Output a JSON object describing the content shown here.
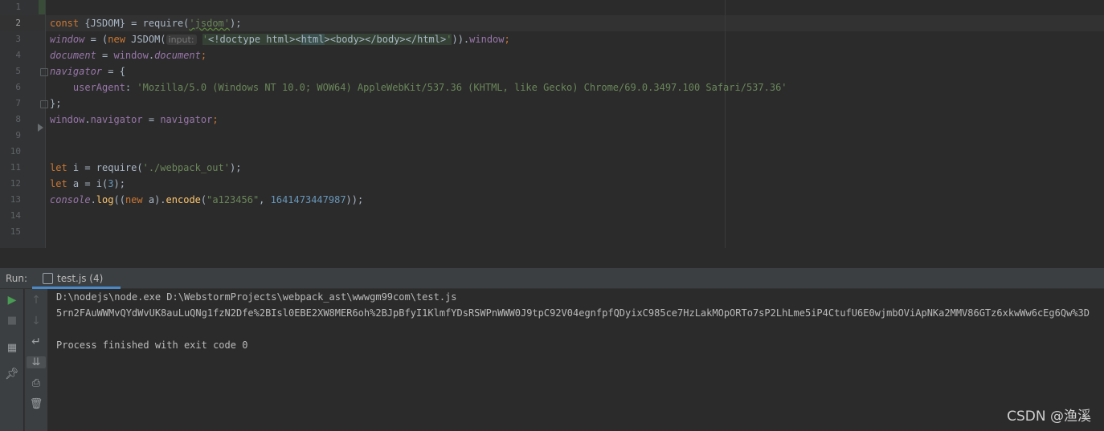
{
  "editor": {
    "line_numbers": [
      "1",
      "2",
      "3",
      "4",
      "5",
      "6",
      "7",
      "8",
      "9",
      "10",
      "11",
      "12",
      "13",
      "14",
      "15"
    ],
    "l2": {
      "a": "const ",
      "b": "{JSDOM}",
      "c": " = require(",
      "d": "'jsdom'",
      "e": ");"
    },
    "l3": {
      "a": "window",
      "b": " = (",
      "c": "new ",
      "d": "JSDOM(",
      "hint": "input:",
      "e": "'",
      "f": "<!doctype html><",
      "g": "html",
      "h": "><body></body></html>",
      "i": "'",
      "j": ")).",
      "k": "window",
      "l": ";"
    },
    "l4": {
      "a": "document",
      "b": " = ",
      "c": "window",
      "d": ".",
      "e": "document",
      "f": ";"
    },
    "l5": {
      "a": "navigator",
      "b": " = {"
    },
    "l6": {
      "a": "    userAgent",
      "b": ": ",
      "c": "'Mozilla/5.0 (Windows NT 10.0; WOW64) AppleWebKit/537.36 (KHTML, like Gecko) Chrome/69.0.3497.100 Safari/537.36'"
    },
    "l7": {
      "a": "};"
    },
    "l8": {
      "a": "window",
      "b": ".",
      "c": "navigator",
      "d": " = ",
      "e": "navigator",
      "f": ";"
    },
    "l11": {
      "a": "let ",
      "b": "i = require(",
      "c": "'./webpack_out'",
      "d": ");"
    },
    "l12": {
      "a": "let ",
      "b": "a = i(",
      "c": "3",
      "d": ");"
    },
    "l13": {
      "a": "console",
      "b": ".",
      "c": "log",
      "d": "((",
      "e": "new ",
      "f": "a).",
      "g": "encode",
      "h": "(",
      "i": "\"a123456\"",
      "j": ", ",
      "k": "1641473447987",
      "l": "));"
    }
  },
  "run_panel": {
    "label": "Run:",
    "tab_label": "test.js (4)",
    "console_lines": [
      "D:\\nodejs\\node.exe D:\\WebstormProjects\\webpack_ast\\wwwgm99com\\test.js",
      "5rn2FAuWWMvQYdWvUK8auLuQNg1fzN2Dfe%2BIsl0EBE2XW8MER6oh%2BJpBfyI1KlmfYDsRSWPnWWW0J9tpC92V04egnfpfQDyixC985ce7HzLakMOpORTo7sP2LhLme5iP4CtufU6E0wjmbOViApNKa2MMV86GTz6xkwWw6cEg6Qw%3D",
      "",
      "Process finished with exit code 0"
    ]
  },
  "watermark": "CSDN @渔溪",
  "colors": {
    "keyword": "#cc7832",
    "global": "#9876aa",
    "string": "#6a8759",
    "number": "#6897bb",
    "function": "#ffc66d",
    "text": "#a9b7c6",
    "accent": "#4a88c7"
  }
}
